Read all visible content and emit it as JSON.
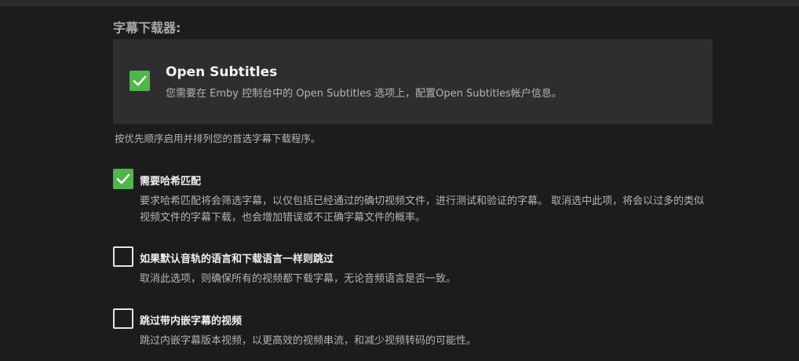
{
  "section": {
    "title": "字幕下载器:"
  },
  "provider": {
    "name": "Open Subtitles",
    "description": "您需要在 Emby 控制台中的 Open Subtitles 选项上，配置Open Subtitles帐户信息。",
    "checked": true
  },
  "hint": "按优先顺序启用并排列您的首选字幕下载程序。",
  "options": [
    {
      "label": "需要哈希匹配",
      "description": "要求哈希匹配将会筛选字幕，以仅包括已经通过的确切视频文件，进行测试和验证的字幕。 取消选中此项，将会以过多的类似视频文件的字幕下载，也会增加错误或不正确字幕文件的概率。",
      "checked": true
    },
    {
      "label": "如果默认音轨的语言和下载语言一样则跳过",
      "description": "取消此选项，则确保所有的视频都下载字幕，无论音频语言是否一致。",
      "checked": false
    },
    {
      "label": "跳过带内嵌字幕的视频",
      "description": "跳过内嵌字幕版本视频，以更高效的视频串流，和减少视频转码的可能性。",
      "checked": false
    }
  ],
  "colors": {
    "accent": "#52b54b",
    "background": "#1c1c1e",
    "panel": "#2e2e31"
  }
}
